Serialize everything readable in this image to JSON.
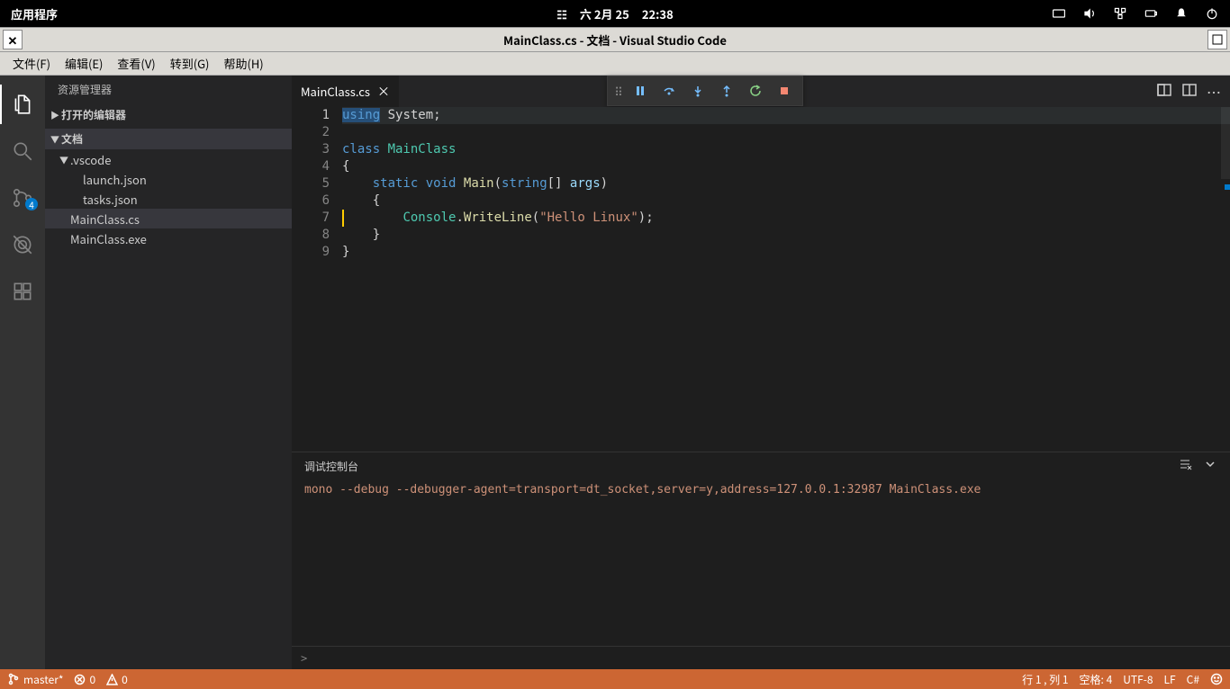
{
  "system_bar": {
    "app_menu": "应用程序",
    "date": "六  2月 25",
    "time": "22:38"
  },
  "title_bar": {
    "title": "MainClass.cs - 文档 - Visual Studio Code"
  },
  "menu": {
    "file": "文件(F)",
    "edit": "编辑(E)",
    "view": "查看(V)",
    "goto": "转到(G)",
    "help": "帮助(H)"
  },
  "activity": {
    "scm_badge": "4"
  },
  "sidebar": {
    "title": "资源管理器",
    "open_editors": "打开的编辑器",
    "folder": "文档",
    "tree": {
      "vscode_folder": ".vscode",
      "launch": "launch.json",
      "tasks": "tasks.json",
      "maincs": "MainClass.cs",
      "mainexe": "MainClass.exe"
    }
  },
  "tabs": {
    "active": "MainClass.cs"
  },
  "code": {
    "lines": [
      [
        {
          "cls": "selkw",
          "t": "using"
        },
        {
          "cls": "pun",
          "t": " System;"
        }
      ],
      [],
      [
        {
          "cls": "kw",
          "t": "class "
        },
        {
          "cls": "cls",
          "t": "MainClass"
        }
      ],
      [
        {
          "cls": "pun",
          "t": "{"
        }
      ],
      [
        {
          "cls": "pun",
          "t": "    "
        },
        {
          "cls": "kw",
          "t": "static"
        },
        {
          "cls": "pun",
          "t": " "
        },
        {
          "cls": "kw",
          "t": "void"
        },
        {
          "cls": "pun",
          "t": " "
        },
        {
          "cls": "mth",
          "t": "Main"
        },
        {
          "cls": "pun",
          "t": "("
        },
        {
          "cls": "typ",
          "t": "string"
        },
        {
          "cls": "pun",
          "t": "[] "
        },
        {
          "cls": "var",
          "t": "args"
        },
        {
          "cls": "pun",
          "t": ")"
        }
      ],
      [
        {
          "cls": "pun",
          "t": "    {"
        }
      ],
      [
        {
          "cls": "pun",
          "t": "        "
        },
        {
          "cls": "cls",
          "t": "Console"
        },
        {
          "cls": "pun",
          "t": "."
        },
        {
          "cls": "mth",
          "t": "WriteLine"
        },
        {
          "cls": "pun",
          "t": "("
        },
        {
          "cls": "str",
          "t": "\"Hello Linux\""
        },
        {
          "cls": "pun",
          "t": ");"
        }
      ],
      [
        {
          "cls": "pun",
          "t": "    }"
        }
      ],
      [
        {
          "cls": "pun",
          "t": "}"
        }
      ]
    ],
    "current_line": 7
  },
  "panel": {
    "title": "调试控制台",
    "output": "mono --debug --debugger-agent=transport=dt_socket,server=y,address=127.0.0.1:32987 MainClass.exe",
    "prompt": ">"
  },
  "status": {
    "branch": "master*",
    "errors": "0",
    "warnings": "0",
    "cursor": "行 1 ,  列 1",
    "spaces": "空格: 4",
    "encoding": "UTF-8",
    "eol": "LF",
    "lang": "C#"
  }
}
